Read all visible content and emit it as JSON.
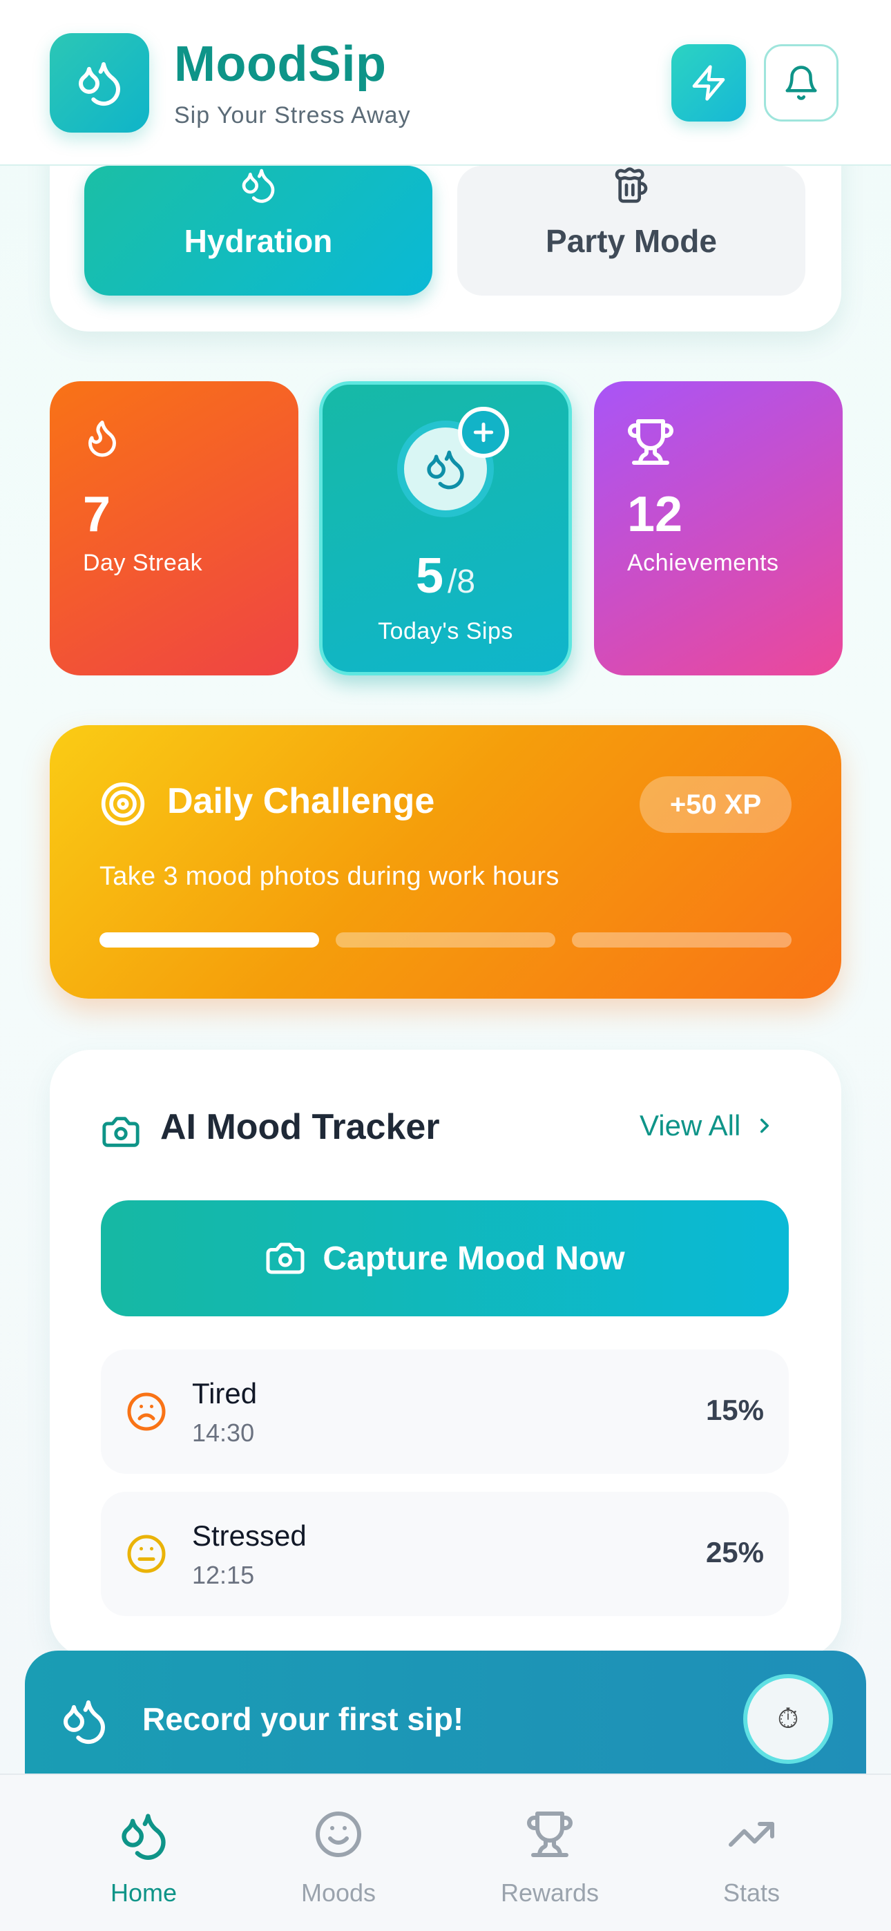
{
  "header": {
    "app_name": "MoodSip",
    "tagline": "Sip Your Stress Away",
    "logo_icon": "droplets-icon",
    "quick_action_icon": "lightning-icon",
    "notifications_icon": "bell-icon"
  },
  "mode_selector": {
    "modes": [
      {
        "label": "Hydration",
        "icon": "droplets-icon",
        "active": true
      },
      {
        "label": "Party Mode",
        "icon": "beer-mug-icon",
        "active": false
      }
    ]
  },
  "stats": {
    "streak": {
      "value": "7",
      "label": "Day Streak",
      "icon": "flame-icon"
    },
    "sips": {
      "count": "5",
      "target": "/8",
      "label": "Today's Sips",
      "icon": "droplets-icon",
      "add_icon": "plus-icon"
    },
    "achievements": {
      "value": "12",
      "label": "Achievements",
      "icon": "trophy-icon"
    }
  },
  "daily_challenge": {
    "title": "Daily Challenge",
    "reward": "+50 XP",
    "description": "Take 3 mood photos during work hours",
    "progress_completed": 1,
    "progress_total": 3,
    "icon": "target-icon"
  },
  "mood_tracker": {
    "title": "AI Mood Tracker",
    "view_all": "View All",
    "capture_label": "Capture Mood Now",
    "entries": [
      {
        "mood": "Tired",
        "time": "14:30",
        "percent": "15%",
        "icon": "frown-face-icon",
        "color": "#f97316"
      },
      {
        "mood": "Stressed",
        "time": "12:15",
        "percent": "25%",
        "icon": "neutral-face-icon",
        "color": "#eab308"
      }
    ]
  },
  "toast": {
    "message": "Record your first sip!",
    "timer_glyph": "⏱"
  },
  "bottom_nav": {
    "items": [
      {
        "label": "Home",
        "icon": "droplets-icon",
        "active": true
      },
      {
        "label": "Moods",
        "icon": "smile-icon",
        "active": false
      },
      {
        "label": "Rewards",
        "icon": "trophy-icon",
        "active": false
      },
      {
        "label": "Stats",
        "icon": "trending-up-icon",
        "active": false
      }
    ]
  },
  "colors": {
    "brand": "#0e9488",
    "teal_gradient": [
      "#1bbfa5",
      "#0ab9d6"
    ],
    "streak_gradient": [
      "#f97316",
      "#ef4444"
    ],
    "achievement_gradient": [
      "#a855f7",
      "#ec4899"
    ],
    "challenge_gradient": [
      "#facc15",
      "#f97316"
    ]
  }
}
